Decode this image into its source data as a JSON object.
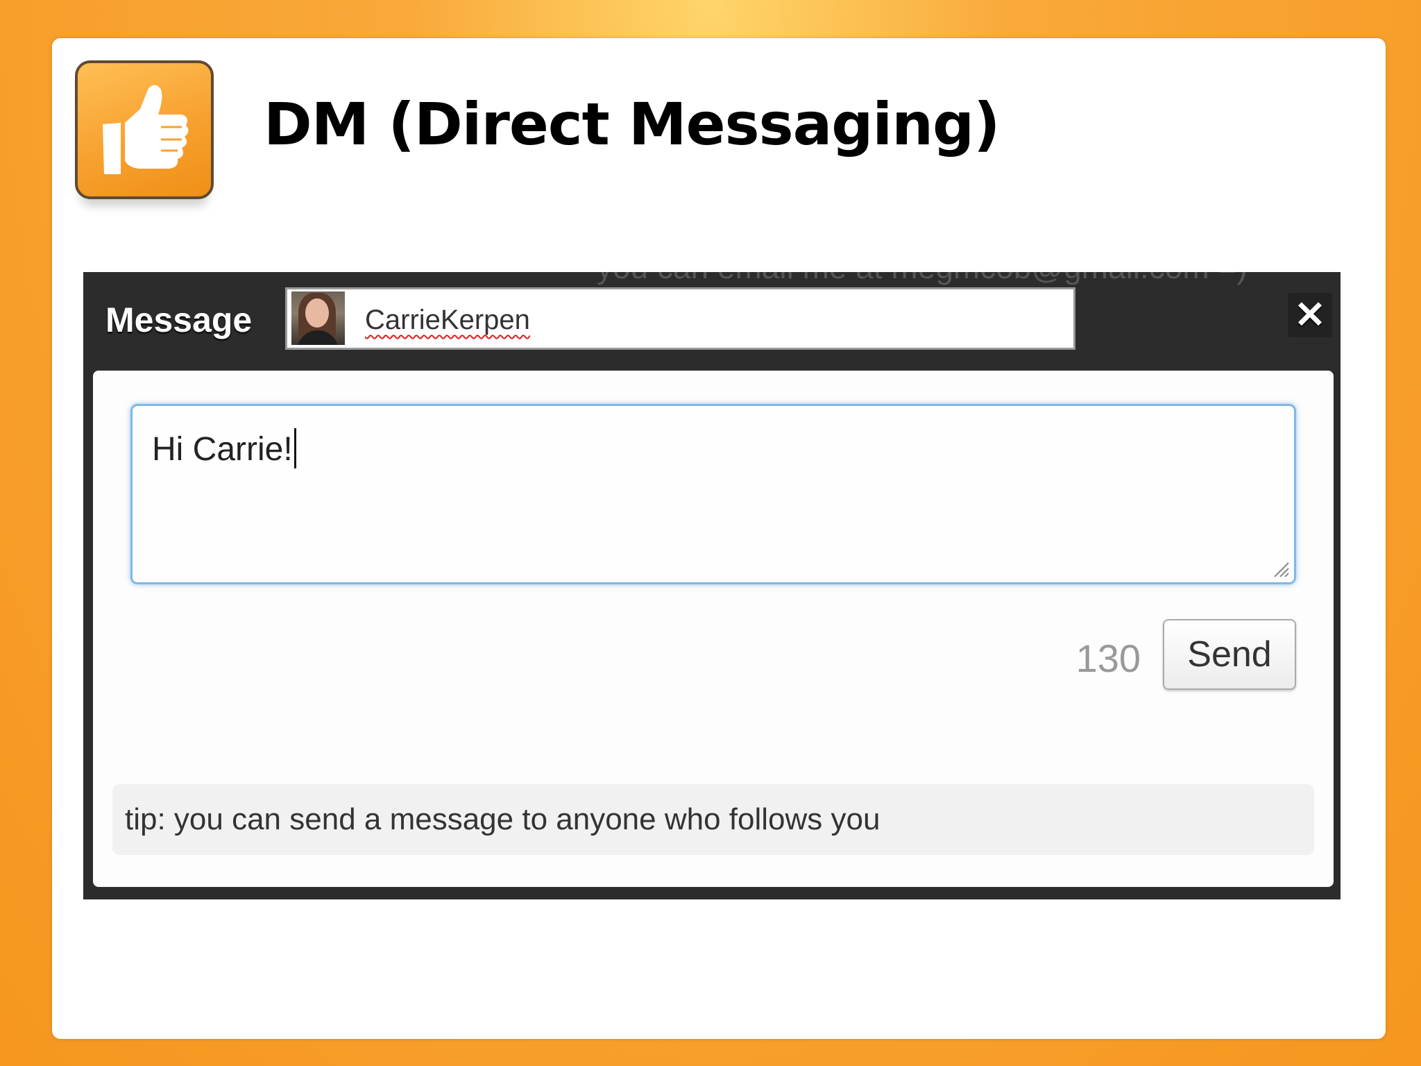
{
  "slide": {
    "title": "DM (Direct Messaging)",
    "icon": "thumbs-up-icon",
    "accent_color": "#f6961f"
  },
  "background_peek": {
    "text": "you can email me at megmcob@gmail.com =)"
  },
  "dm_dialog": {
    "header_label": "Message",
    "recipient": {
      "name": "CarrieKerpen",
      "avatar": "user-avatar"
    },
    "close_icon": "close-icon",
    "close_symbol": "✕",
    "message_value": "Hi Carrie!",
    "char_count": "130",
    "send_label": "Send",
    "tip": "tip: you can send a message to anyone who follows you",
    "focus_color": "#7fb8e6"
  }
}
